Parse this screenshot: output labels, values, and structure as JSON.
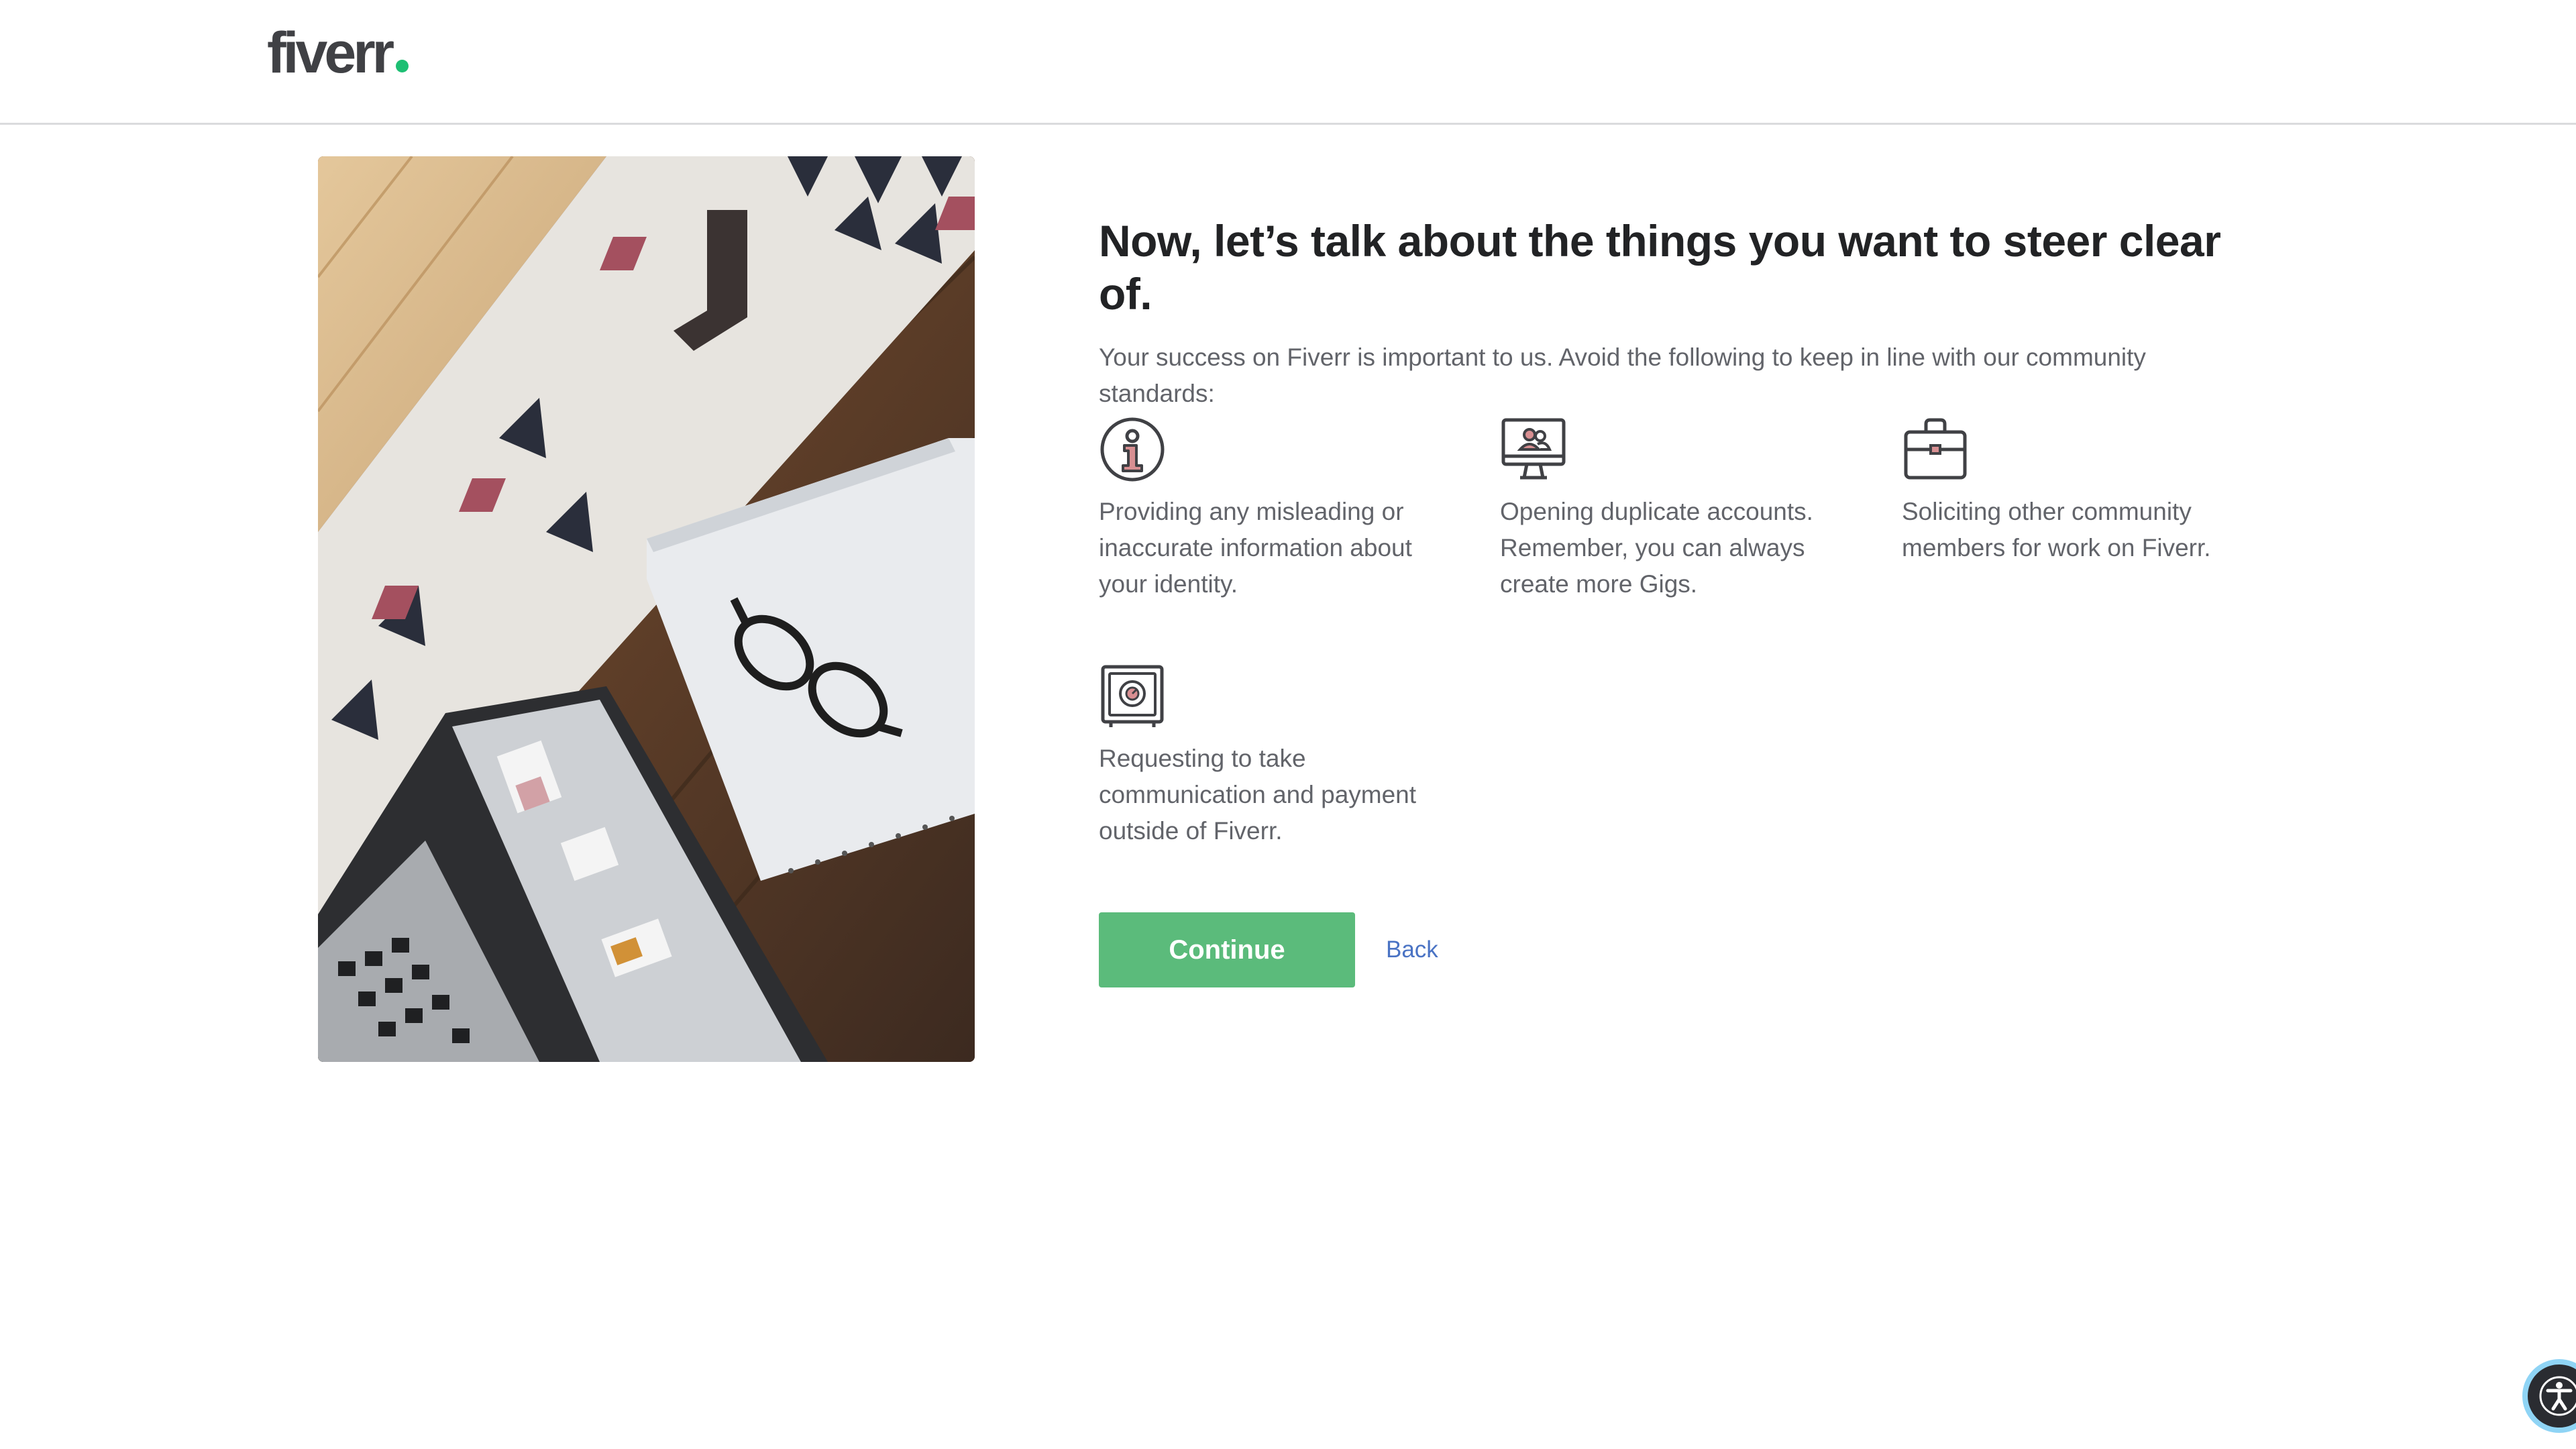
{
  "header": {
    "logo_text": "fiverr",
    "logo_dot_color": "#1dbf73"
  },
  "photo": {
    "alt": "laptop, notebook and glasses on a wooden floor with a patterned rug"
  },
  "main": {
    "title": "Now, let’s talk about the things you want to steer clear of.",
    "subtitle": "Your success on Fiverr is important to us. Avoid the following to keep in line with our community standards:",
    "items": [
      {
        "icon": "info-icon",
        "text": "Providing any misleading or inaccurate information about your identity."
      },
      {
        "icon": "monitor-user-icon",
        "text": "Opening duplicate accounts. Remember, you can always create more Gigs."
      },
      {
        "icon": "briefcase-icon",
        "text": "Soliciting other community members for work on Fiverr."
      },
      {
        "icon": "safe-icon",
        "text": "Requesting to take communication and payment outside of Fiverr."
      }
    ]
  },
  "actions": {
    "continue_label": "Continue",
    "back_label": "Back"
  },
  "colors": {
    "primary_button": "#5bbb7b",
    "link": "#4a73c4",
    "icon_accent": "#d88f92"
  },
  "accessibility": {
    "icon": "accessibility-icon"
  }
}
